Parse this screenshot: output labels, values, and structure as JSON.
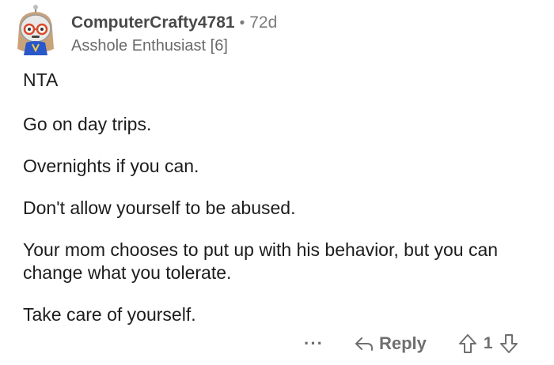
{
  "comment": {
    "username": "ComputerCrafty4781",
    "separator": "•",
    "age": "72d",
    "flair": "Asshole Enthusiast [6]",
    "paragraphs": [
      "NTA",
      "Go on day trips.",
      "Overnights if you can.",
      "Don't allow yourself to be abused.",
      "Your mom chooses to put up with his behavior, but you can change what you tolerate.",
      "Take care of yourself."
    ]
  },
  "actions": {
    "more_label": "···",
    "reply_label": "Reply",
    "score": "1",
    "icons": [
      "more-icon",
      "reply-arrow-icon",
      "upvote-icon",
      "downvote-icon"
    ]
  },
  "colors": {
    "text": "#1c1c1c",
    "meta": "#7c7c7c",
    "username": "#4a4a4a"
  }
}
